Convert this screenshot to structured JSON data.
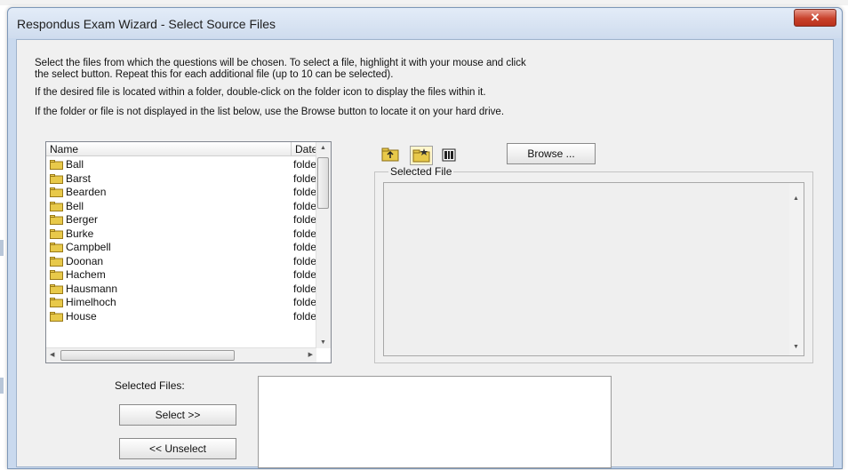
{
  "window": {
    "title": "Respondus Exam Wizard - Select Source Files",
    "close_symbol": "✕"
  },
  "instructions": {
    "line1": "Select the files from which the questions will be chosen.  To select a file, highlight it with your mouse and click",
    "line2": "the select button.  Repeat this for each additional file (up to 10 can be selected).",
    "line3": "If the desired file is located within a folder, double-click on the folder icon to display the files within it.",
    "line4": "If the folder or file is not displayed in the list below, use the Browse button to locate it on your hard drive."
  },
  "file_list": {
    "columns": {
      "name": "Name",
      "date": "Date"
    },
    "rows": [
      {
        "name": "Ball",
        "date": "folder"
      },
      {
        "name": "Barst",
        "date": "folder"
      },
      {
        "name": "Bearden",
        "date": "folder"
      },
      {
        "name": "Bell",
        "date": "folder"
      },
      {
        "name": "Berger",
        "date": "folder"
      },
      {
        "name": "Burke",
        "date": "folder"
      },
      {
        "name": "Campbell",
        "date": "folder"
      },
      {
        "name": "Doonan",
        "date": "folder"
      },
      {
        "name": "Hachem",
        "date": "folder"
      },
      {
        "name": "Hausmann",
        "date": "folder"
      },
      {
        "name": "Himelhoch",
        "date": "folder"
      },
      {
        "name": "House",
        "date": "folder"
      }
    ]
  },
  "toolbar": {
    "up_folder_icon": "folder-up-icon",
    "new_folder_icon": "new-folder-icon",
    "details_icon": "details-view-icon",
    "browse_label": "Browse ..."
  },
  "selected_file": {
    "group_label": "Selected File"
  },
  "selected_files": {
    "label": "Selected Files:",
    "select_label": "Select >>",
    "unselect_label": "<< Unselect"
  },
  "colors": {
    "window_frame": "#c9d9ee",
    "dialog_bg": "#f0f0f0",
    "close_button": "#c8412b",
    "folder_icon": "#e8c94a"
  }
}
